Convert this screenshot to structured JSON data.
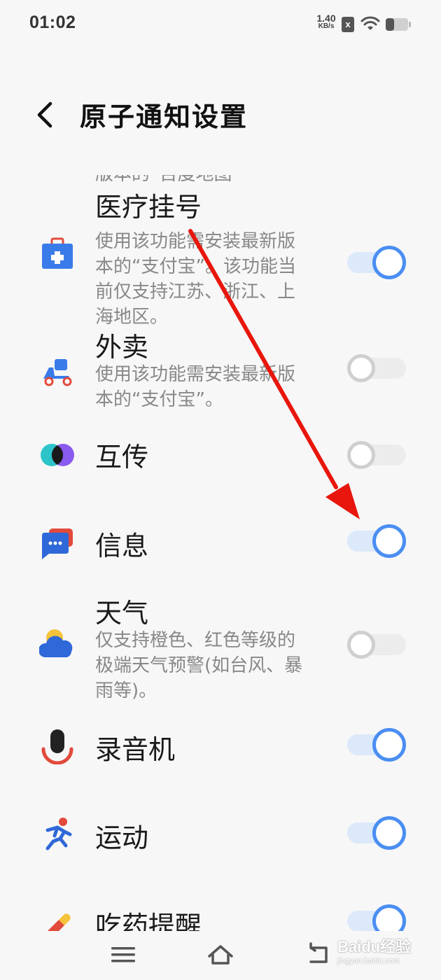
{
  "status_bar": {
    "time": "01:02",
    "net_speed_value": "1.40",
    "net_speed_unit": "KB/s",
    "sim_badge": "x",
    "icons": [
      "wifi-icon",
      "battery-icon"
    ]
  },
  "header": {
    "title": "原子通知设置",
    "back_icon": "chevron-left-icon"
  },
  "clipped_text": "版本的“百度地图”",
  "items": [
    {
      "title": "医疗挂号",
      "desc": "使用该功能需安装最新版本的“支付宝”。该功能当前仅支持江苏、浙江、上海地区。",
      "icon": "medical-kit-icon",
      "enabled": true
    },
    {
      "title": "外卖",
      "desc": "使用该功能需安装最新版本的“支付宝”。",
      "icon": "delivery-scooter-icon",
      "enabled": false
    },
    {
      "title": "互传",
      "desc": "",
      "icon": "share-circles-icon",
      "enabled": false
    },
    {
      "title": "信息",
      "desc": "",
      "icon": "message-bubble-icon",
      "enabled": true
    },
    {
      "title": "天气",
      "desc": "仅支持橙色、红色等级的极端天气预警(如台风、暴雨等)。",
      "icon": "weather-cloud-icon",
      "enabled": false
    },
    {
      "title": "录音机",
      "desc": "",
      "icon": "microphone-icon",
      "enabled": true
    },
    {
      "title": "运动",
      "desc": "",
      "icon": "running-person-icon",
      "enabled": true
    },
    {
      "title": "吃药提醒",
      "desc": "",
      "icon": "pill-icon",
      "enabled": true
    }
  ],
  "nav_bar": {
    "icons": [
      "menu-icon",
      "home-icon",
      "back-icon"
    ]
  },
  "watermark": {
    "brand": "Baidu经验",
    "site": "jingyan.baidu.com"
  },
  "colors": {
    "toggle_on": "#4a8ef2",
    "toggle_on_track": "#dce9fb",
    "toggle_off": "#cfcfcf",
    "annotation_arrow": "#e8160c"
  }
}
